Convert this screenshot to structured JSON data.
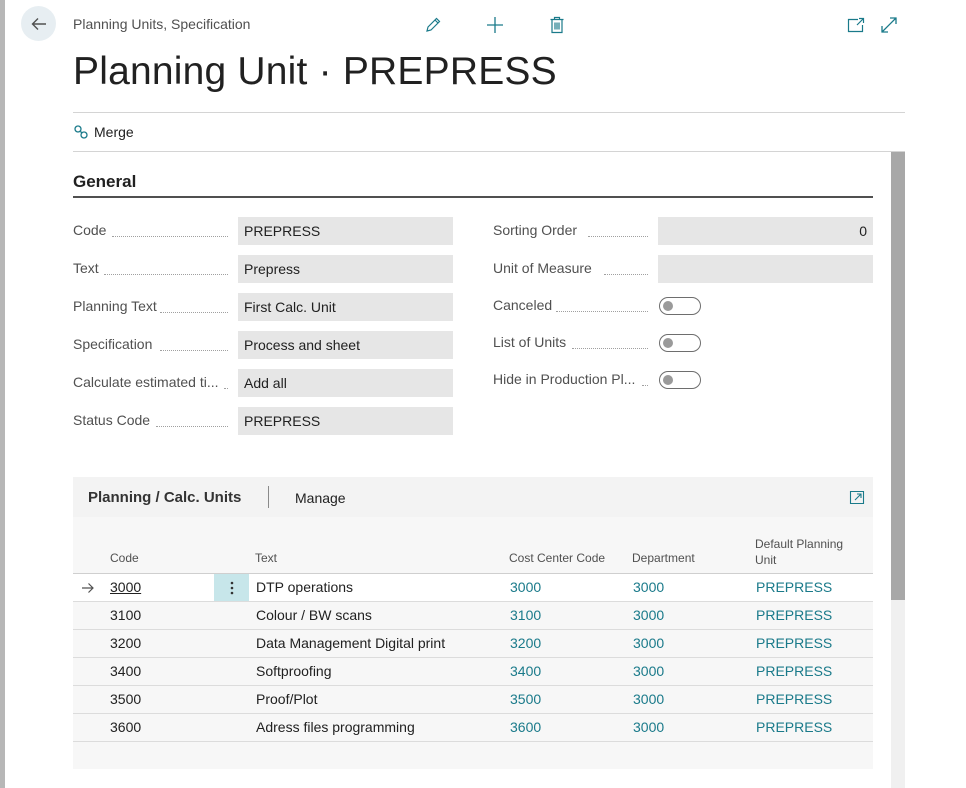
{
  "header": {
    "breadcrumb": "Planning Units, Specification",
    "title": "Planning Unit · PREPRESS"
  },
  "actions": {
    "merge_label": "Merge"
  },
  "general": {
    "section_title": "General",
    "left_fields": [
      {
        "label": "Code",
        "value": "PREPRESS"
      },
      {
        "label": "Text",
        "value": "Prepress"
      },
      {
        "label": "Planning Text",
        "value": "First Calc. Unit"
      },
      {
        "label": "Specification",
        "value": "Process and sheet"
      },
      {
        "label": "Calculate estimated ti...",
        "value": "Add all"
      },
      {
        "label": "Status Code",
        "value": "PREPRESS"
      }
    ],
    "right_fields": [
      {
        "label": "Sorting Order",
        "value": "0"
      },
      {
        "label": "Unit of Measure",
        "value": ""
      }
    ],
    "toggles": [
      {
        "label": "Canceled",
        "on": false
      },
      {
        "label": "List of Units",
        "on": false
      },
      {
        "label": "Hide in Production Pl...",
        "on": false
      }
    ]
  },
  "subpage": {
    "title": "Planning / Calc. Units",
    "manage_label": "Manage",
    "columns": {
      "code": "Code",
      "text": "Text",
      "cost_center": "Cost Center Code",
      "department": "Department",
      "default_planning_1": "Default Planning",
      "default_planning_2": "Unit"
    },
    "rows": [
      {
        "code": "3000",
        "text": "DTP operations",
        "cost_center": "3000",
        "department": "3000",
        "default_unit": "PREPRESS"
      },
      {
        "code": "3100",
        "text": "Colour / BW scans",
        "cost_center": "3100",
        "department": "3000",
        "default_unit": "PREPRESS"
      },
      {
        "code": "3200",
        "text": "Data Management Digital print",
        "cost_center": "3200",
        "department": "3000",
        "default_unit": "PREPRESS"
      },
      {
        "code": "3400",
        "text": "Softproofing",
        "cost_center": "3400",
        "department": "3000",
        "default_unit": "PREPRESS"
      },
      {
        "code": "3500",
        "text": "Proof/Plot",
        "cost_center": "3500",
        "department": "3000",
        "default_unit": "PREPRESS"
      },
      {
        "code": "3600",
        "text": "Adress files programming",
        "cost_center": "3600",
        "department": "3000",
        "default_unit": "PREPRESS"
      }
    ]
  },
  "colors": {
    "accent": "#1a7a8a",
    "field_bg": "#e6e6e6",
    "row_menu_bg": "#c7e6ea"
  }
}
